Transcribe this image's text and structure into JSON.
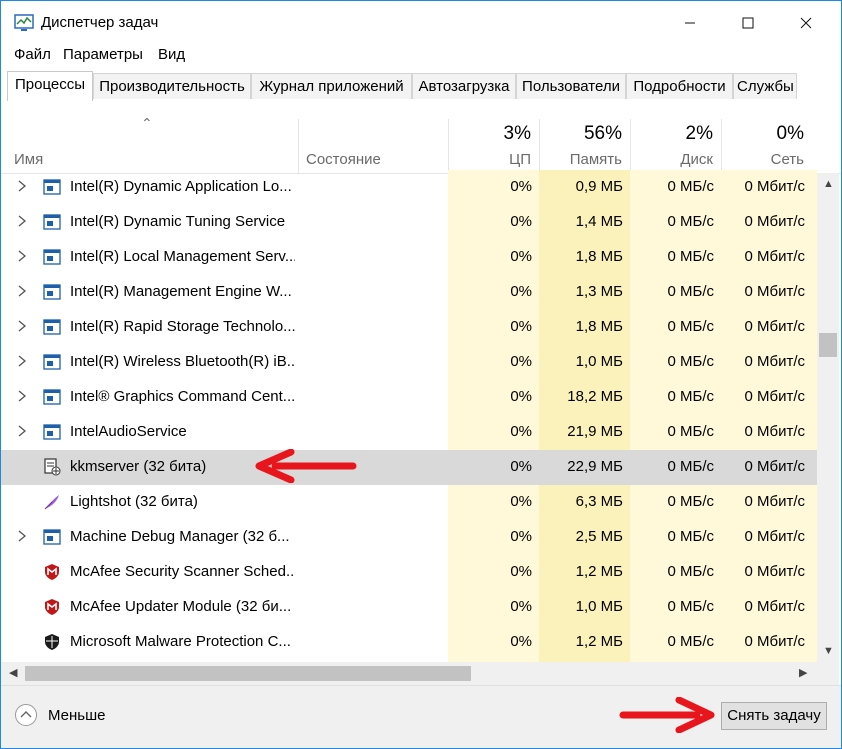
{
  "window": {
    "title": "Диспетчер задач"
  },
  "menu": [
    "Файл",
    "Параметры",
    "Вид"
  ],
  "tabs": [
    "Процессы",
    "Производительность",
    "Журнал приложений",
    "Автозагрузка",
    "Пользователи",
    "Подробности",
    "Службы"
  ],
  "active_tab": "Процессы",
  "columns": {
    "name": "Имя",
    "status": "Состояние",
    "cpu": {
      "percent": "3%",
      "label": "ЦП"
    },
    "memory": {
      "percent": "56%",
      "label": "Память"
    },
    "disk": {
      "percent": "2%",
      "label": "Диск"
    },
    "network": {
      "percent": "0%",
      "label": "Сеть"
    }
  },
  "processes": [
    {
      "expand": true,
      "icon": "service-window-icon",
      "name": "Intel(R) Dynamic Application Lo...",
      "cpu": "0%",
      "memory": "0,9 МБ",
      "disk": "0 МБ/с",
      "network": "0 Мбит/с"
    },
    {
      "expand": true,
      "icon": "service-window-icon",
      "name": "Intel(R) Dynamic Tuning Service",
      "cpu": "0%",
      "memory": "1,4 МБ",
      "disk": "0 МБ/с",
      "network": "0 Мбит/с"
    },
    {
      "expand": true,
      "icon": "service-window-icon",
      "name": "Intel(R) Local Management Serv...",
      "cpu": "0%",
      "memory": "1,8 МБ",
      "disk": "0 МБ/с",
      "network": "0 Мбит/с"
    },
    {
      "expand": true,
      "icon": "service-window-icon",
      "name": "Intel(R) Management Engine W...",
      "cpu": "0%",
      "memory": "1,3 МБ",
      "disk": "0 МБ/с",
      "network": "0 Мбит/с"
    },
    {
      "expand": true,
      "icon": "service-window-icon",
      "name": "Intel(R) Rapid Storage Technolo...",
      "cpu": "0%",
      "memory": "1,8 МБ",
      "disk": "0 МБ/с",
      "network": "0 Мбит/с"
    },
    {
      "expand": true,
      "icon": "service-window-icon",
      "name": "Intel(R) Wireless Bluetooth(R) iB...",
      "cpu": "0%",
      "memory": "1,0 МБ",
      "disk": "0 МБ/с",
      "network": "0 Мбит/с"
    },
    {
      "expand": true,
      "icon": "service-window-icon",
      "name": "Intel® Graphics Command Cent...",
      "cpu": "0%",
      "memory": "18,2 МБ",
      "disk": "0 МБ/с",
      "network": "0 Мбит/с"
    },
    {
      "expand": true,
      "icon": "service-window-icon",
      "name": "IntelAudioService",
      "cpu": "0%",
      "memory": "21,9 МБ",
      "disk": "0 МБ/с",
      "network": "0 Мбит/с"
    },
    {
      "expand": false,
      "icon": "kkm-document-icon",
      "name": "kkmserver (32 бита)",
      "cpu": "0%",
      "memory": "22,9 МБ",
      "disk": "0 МБ/с",
      "network": "0 Мбит/с",
      "selected": true
    },
    {
      "expand": false,
      "icon": "lightshot-feather-icon",
      "name": "Lightshot (32 бита)",
      "cpu": "0%",
      "memory": "6,3 МБ",
      "disk": "0 МБ/с",
      "network": "0 Мбит/с"
    },
    {
      "expand": true,
      "icon": "service-window-icon",
      "name": "Machine Debug Manager (32 б...",
      "cpu": "0%",
      "memory": "2,5 МБ",
      "disk": "0 МБ/с",
      "network": "0 Мбит/с"
    },
    {
      "expand": false,
      "icon": "mcafee-shield-icon",
      "name": "McAfee Security Scanner Sched...",
      "cpu": "0%",
      "memory": "1,2 МБ",
      "disk": "0 МБ/с",
      "network": "0 Мбит/с"
    },
    {
      "expand": false,
      "icon": "mcafee-shield-icon",
      "name": "McAfee Updater Module (32 би...",
      "cpu": "0%",
      "memory": "1,0 МБ",
      "disk": "0 МБ/с",
      "network": "0 Мбит/с"
    },
    {
      "expand": false,
      "icon": "defender-shield-icon",
      "name": "Microsoft Malware Protection C...",
      "cpu": "0%",
      "memory": "1,2 МБ",
      "disk": "0 МБ/с",
      "network": "0 Мбит/с"
    }
  ],
  "footer": {
    "less_label": "Меньше",
    "end_task_label": "Снять задачу"
  },
  "colors": {
    "cpu_column": "#fff9d9",
    "memory_column": "#fbf1bb",
    "accent_arrow": "#e8161c",
    "window_border": "#1e88e5"
  }
}
